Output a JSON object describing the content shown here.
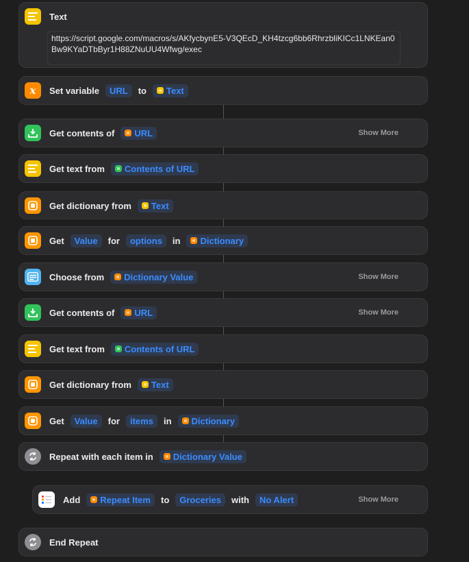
{
  "text_action": {
    "title": "Text",
    "value": "https://script.google.com/macros/s/AKfycbynE5-V3QEcD_KH4tzcg6bb6RhrzbliKICc1LNKEan0Bw9KYaDTbByr1H88ZNuUU4Wfwg/exec"
  },
  "set_variable": {
    "label": "Set variable",
    "var": "URL",
    "to": "to",
    "value": "Text"
  },
  "get_contents_1": {
    "label": "Get contents of",
    "token": "URL",
    "show_more": "Show More"
  },
  "get_text_1": {
    "label": "Get text from",
    "token": "Contents of URL"
  },
  "get_dict_1": {
    "label": "Get dictionary from",
    "token": "Text"
  },
  "get_value_1": {
    "label": "Get",
    "value": "Value",
    "for": "for",
    "key": "options",
    "in": "in",
    "dict": "Dictionary"
  },
  "choose_from": {
    "label": "Choose from",
    "token": "Dictionary Value",
    "show_more": "Show More"
  },
  "get_contents_2": {
    "label": "Get contents of",
    "token": "URL",
    "show_more": "Show More"
  },
  "get_text_2": {
    "label": "Get text from",
    "token": "Contents of URL"
  },
  "get_dict_2": {
    "label": "Get dictionary from",
    "token": "Text"
  },
  "get_value_2": {
    "label": "Get",
    "value": "Value",
    "for": "for",
    "key": "items",
    "in": "in",
    "dict": "Dictionary"
  },
  "repeat": {
    "label": "Repeat with each item in",
    "token": "Dictionary Value"
  },
  "add": {
    "label": "Add",
    "item": "Repeat Item",
    "to": "to",
    "list": "Groceries",
    "with": "with",
    "alert": "No Alert",
    "show_more": "Show More"
  },
  "end_repeat": {
    "label": "End Repeat"
  },
  "colors": {
    "yellow": "#f5c400",
    "orange": "#ff8a00",
    "green": "#30c35a",
    "blue": "#4fb3f0",
    "gray": "#8e8e93",
    "token_text": "#3b8cff"
  }
}
